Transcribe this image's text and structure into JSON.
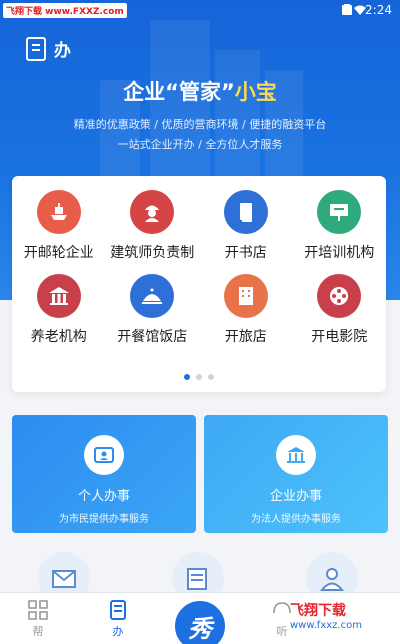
{
  "status": {
    "source_tag": "飞翔下载 www.FXXZ.com",
    "time": "2:24"
  },
  "header": {
    "title": "办",
    "slogan_main": "企业“管家”",
    "slogan_accent": "小宝",
    "sub1": "精准的优惠政策 / 优质的营商环境 / 便捷的融资平台",
    "sub2": "一站式企业开办 / 全方位人才服务"
  },
  "services": [
    {
      "label": "开邮轮企业",
      "color": "#e85c4a"
    },
    {
      "label": "建筑师负责制",
      "color": "#d64545"
    },
    {
      "label": "开书店",
      "color": "#2f6fd8"
    },
    {
      "label": "开培训机构",
      "color": "#2eaa7c"
    },
    {
      "label": "养老机构",
      "color": "#c8404a"
    },
    {
      "label": "开餐馆饭店",
      "color": "#2f6fd8"
    },
    {
      "label": "开旅店",
      "color": "#e8734a"
    },
    {
      "label": "开电影院",
      "color": "#c8404a"
    }
  ],
  "cards": {
    "personal_title": "个人办事",
    "personal_sub": "为市民提供办事服务",
    "corporate_title": "企业办事",
    "corporate_sub": "为法人提供办事服务"
  },
  "tabs": {
    "help": "帮",
    "handle": "办",
    "center": "秀",
    "listen": "听"
  },
  "watermark": {
    "logo": "飞翔下载",
    "url": "www.fxxz.com"
  },
  "colors": {
    "primary": "#1e6fe0",
    "accent": "#ffd84a"
  }
}
